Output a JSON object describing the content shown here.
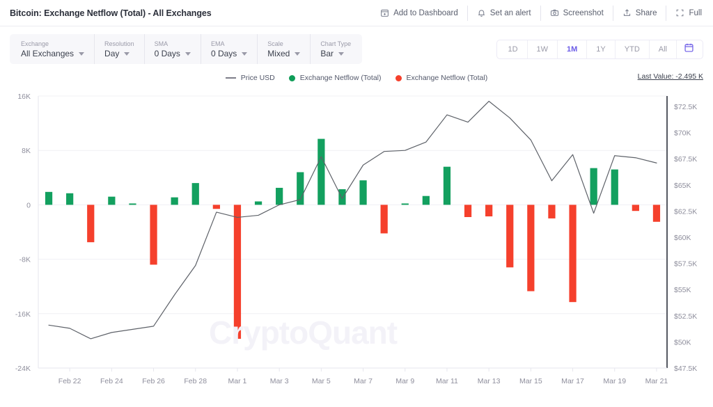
{
  "header": {
    "title": "Bitcoin: Exchange Netflow (Total) - All Exchanges",
    "actions": [
      {
        "label": "Add to Dashboard",
        "icon": "add-to-dashboard-icon"
      },
      {
        "label": "Set an alert",
        "icon": "bell-icon"
      },
      {
        "label": "Screenshot",
        "icon": "camera-icon"
      },
      {
        "label": "Share",
        "icon": "share-icon"
      },
      {
        "label": "Full",
        "icon": "fullscreen-icon"
      }
    ]
  },
  "filters": [
    {
      "label": "Exchange",
      "value": "All Exchanges"
    },
    {
      "label": "Resolution",
      "value": "Day"
    },
    {
      "label": "SMA",
      "value": "0 Days"
    },
    {
      "label": "EMA",
      "value": "0 Days"
    },
    {
      "label": "Scale",
      "value": "Mixed"
    },
    {
      "label": "Chart Type",
      "value": "Bar"
    }
  ],
  "range": {
    "options": [
      "1D",
      "1W",
      "1M",
      "1Y",
      "YTD",
      "All"
    ],
    "active": "1M",
    "calendar_icon": "calendar-icon"
  },
  "legend": [
    {
      "label": "Price USD",
      "marker": "line",
      "color": "#7d7d88"
    },
    {
      "label": "Exchange Netflow (Total)",
      "marker": "dot",
      "color": "#0f9d58"
    },
    {
      "label": "Exchange Netflow (Total)",
      "marker": "dot",
      "color": "#f5402c"
    }
  ],
  "last_value": "Last Value: -2.495 K",
  "watermark": "CryptoQuant",
  "colors": {
    "positive": "#13a05f",
    "negative": "#f5402c",
    "price_line": "#5d6168",
    "grid": "#f0f0f4",
    "axis_text": "#8e8e9c",
    "accent": "#6c5ce7"
  },
  "chart_data": {
    "type": "bar",
    "title": "Bitcoin: Exchange Netflow (Total) - All Exchanges",
    "xlabel": "",
    "ylabel": "Exchange Netflow (Total)",
    "y2label": "Price USD",
    "grid": true,
    "legend_position": "top-center",
    "ylim": [
      -24000,
      16000
    ],
    "yticks": [
      16000,
      8000,
      0,
      -8000,
      -16000,
      -24000
    ],
    "ytick_labels": [
      "16K",
      "8K",
      "0",
      "-8K",
      "-16K",
      "-24K"
    ],
    "y2lim": [
      47500,
      73500
    ],
    "y2ticks": [
      72500,
      70000,
      67500,
      65000,
      62500,
      60000,
      57500,
      55000,
      52500,
      50000,
      47500
    ],
    "y2tick_labels": [
      "$72.5K",
      "$70K",
      "$67.5K",
      "$65K",
      "$62.5K",
      "$60K",
      "$57.5K",
      "$55K",
      "$52.5K",
      "$50K",
      "$47.5K"
    ],
    "xtick_labels": [
      "Feb 22",
      "Feb 24",
      "Feb 26",
      "Feb 28",
      "Mar 1",
      "Mar 3",
      "Mar 5",
      "Mar 7",
      "Mar 9",
      "Mar 11",
      "Mar 13",
      "Mar 15",
      "Mar 17",
      "Mar 19",
      "Mar 21"
    ],
    "categories": [
      "Feb 21",
      "Feb 22",
      "Feb 23",
      "Feb 24",
      "Feb 25",
      "Feb 26",
      "Feb 27",
      "Feb 28",
      "Feb 29",
      "Mar 1",
      "Mar 2",
      "Mar 3",
      "Mar 4",
      "Mar 5",
      "Mar 6",
      "Mar 7",
      "Mar 8",
      "Mar 9",
      "Mar 10",
      "Mar 11",
      "Mar 12",
      "Mar 13",
      "Mar 14",
      "Mar 15",
      "Mar 16",
      "Mar 17",
      "Mar 18",
      "Mar 19",
      "Mar 20",
      "Mar 21"
    ],
    "series": [
      {
        "name": "Exchange Netflow (Total)",
        "type": "bar",
        "axis": "left",
        "positive_color": "#13a05f",
        "negative_color": "#f5402c",
        "values": [
          1900,
          1700,
          -5500,
          1200,
          200,
          -8800,
          1100,
          3200,
          -600,
          -19700,
          500,
          2500,
          4800,
          9700,
          2300,
          3600,
          -4200,
          200,
          1300,
          5600,
          -1800,
          -1700,
          -9200,
          -12700,
          -2000,
          -14300,
          5400,
          5200,
          -900,
          -2495
        ]
      },
      {
        "name": "Price USD",
        "type": "line",
        "axis": "right",
        "color": "#5d6168",
        "values": [
          51600,
          51300,
          50300,
          50900,
          51200,
          51500,
          54500,
          57300,
          62400,
          61900,
          62100,
          63100,
          63600,
          67700,
          63700,
          66900,
          68200,
          68300,
          69100,
          71700,
          71000,
          73000,
          71400,
          69300,
          65400,
          67900,
          62300,
          67800,
          67600,
          67100
        ]
      }
    ]
  }
}
